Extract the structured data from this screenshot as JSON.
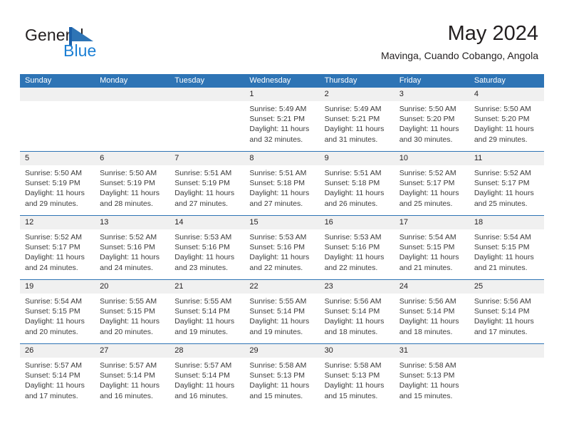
{
  "brand": {
    "name_part1": "General",
    "name_part2": "Blue",
    "logo_icon": "blue-flag-triangle-logo",
    "accent_color": "#1b7fd4"
  },
  "header": {
    "month_title": "May 2024",
    "location": "Mavinga, Cuando Cobango, Angola"
  },
  "theme": {
    "header_blue": "#2e74b5",
    "daynum_band": "#f0f0f0",
    "text": "#231f20",
    "detail_text": "#3b3b3b"
  },
  "calendar": {
    "weekday_headers": [
      "Sunday",
      "Monday",
      "Tuesday",
      "Wednesday",
      "Thursday",
      "Friday",
      "Saturday"
    ],
    "weeks": [
      [
        {
          "day": "",
          "lines": []
        },
        {
          "day": "",
          "lines": []
        },
        {
          "day": "",
          "lines": []
        },
        {
          "day": "1",
          "lines": [
            "Sunrise: 5:49 AM",
            "Sunset: 5:21 PM",
            "Daylight: 11 hours",
            "and 32 minutes."
          ]
        },
        {
          "day": "2",
          "lines": [
            "Sunrise: 5:49 AM",
            "Sunset: 5:21 PM",
            "Daylight: 11 hours",
            "and 31 minutes."
          ]
        },
        {
          "day": "3",
          "lines": [
            "Sunrise: 5:50 AM",
            "Sunset: 5:20 PM",
            "Daylight: 11 hours",
            "and 30 minutes."
          ]
        },
        {
          "day": "4",
          "lines": [
            "Sunrise: 5:50 AM",
            "Sunset: 5:20 PM",
            "Daylight: 11 hours",
            "and 29 minutes."
          ]
        }
      ],
      [
        {
          "day": "5",
          "lines": [
            "Sunrise: 5:50 AM",
            "Sunset: 5:19 PM",
            "Daylight: 11 hours",
            "and 29 minutes."
          ]
        },
        {
          "day": "6",
          "lines": [
            "Sunrise: 5:50 AM",
            "Sunset: 5:19 PM",
            "Daylight: 11 hours",
            "and 28 minutes."
          ]
        },
        {
          "day": "7",
          "lines": [
            "Sunrise: 5:51 AM",
            "Sunset: 5:19 PM",
            "Daylight: 11 hours",
            "and 27 minutes."
          ]
        },
        {
          "day": "8",
          "lines": [
            "Sunrise: 5:51 AM",
            "Sunset: 5:18 PM",
            "Daylight: 11 hours",
            "and 27 minutes."
          ]
        },
        {
          "day": "9",
          "lines": [
            "Sunrise: 5:51 AM",
            "Sunset: 5:18 PM",
            "Daylight: 11 hours",
            "and 26 minutes."
          ]
        },
        {
          "day": "10",
          "lines": [
            "Sunrise: 5:52 AM",
            "Sunset: 5:17 PM",
            "Daylight: 11 hours",
            "and 25 minutes."
          ]
        },
        {
          "day": "11",
          "lines": [
            "Sunrise: 5:52 AM",
            "Sunset: 5:17 PM",
            "Daylight: 11 hours",
            "and 25 minutes."
          ]
        }
      ],
      [
        {
          "day": "12",
          "lines": [
            "Sunrise: 5:52 AM",
            "Sunset: 5:17 PM",
            "Daylight: 11 hours",
            "and 24 minutes."
          ]
        },
        {
          "day": "13",
          "lines": [
            "Sunrise: 5:52 AM",
            "Sunset: 5:16 PM",
            "Daylight: 11 hours",
            "and 24 minutes."
          ]
        },
        {
          "day": "14",
          "lines": [
            "Sunrise: 5:53 AM",
            "Sunset: 5:16 PM",
            "Daylight: 11 hours",
            "and 23 minutes."
          ]
        },
        {
          "day": "15",
          "lines": [
            "Sunrise: 5:53 AM",
            "Sunset: 5:16 PM",
            "Daylight: 11 hours",
            "and 22 minutes."
          ]
        },
        {
          "day": "16",
          "lines": [
            "Sunrise: 5:53 AM",
            "Sunset: 5:16 PM",
            "Daylight: 11 hours",
            "and 22 minutes."
          ]
        },
        {
          "day": "17",
          "lines": [
            "Sunrise: 5:54 AM",
            "Sunset: 5:15 PM",
            "Daylight: 11 hours",
            "and 21 minutes."
          ]
        },
        {
          "day": "18",
          "lines": [
            "Sunrise: 5:54 AM",
            "Sunset: 5:15 PM",
            "Daylight: 11 hours",
            "and 21 minutes."
          ]
        }
      ],
      [
        {
          "day": "19",
          "lines": [
            "Sunrise: 5:54 AM",
            "Sunset: 5:15 PM",
            "Daylight: 11 hours",
            "and 20 minutes."
          ]
        },
        {
          "day": "20",
          "lines": [
            "Sunrise: 5:55 AM",
            "Sunset: 5:15 PM",
            "Daylight: 11 hours",
            "and 20 minutes."
          ]
        },
        {
          "day": "21",
          "lines": [
            "Sunrise: 5:55 AM",
            "Sunset: 5:14 PM",
            "Daylight: 11 hours",
            "and 19 minutes."
          ]
        },
        {
          "day": "22",
          "lines": [
            "Sunrise: 5:55 AM",
            "Sunset: 5:14 PM",
            "Daylight: 11 hours",
            "and 19 minutes."
          ]
        },
        {
          "day": "23",
          "lines": [
            "Sunrise: 5:56 AM",
            "Sunset: 5:14 PM",
            "Daylight: 11 hours",
            "and 18 minutes."
          ]
        },
        {
          "day": "24",
          "lines": [
            "Sunrise: 5:56 AM",
            "Sunset: 5:14 PM",
            "Daylight: 11 hours",
            "and 18 minutes."
          ]
        },
        {
          "day": "25",
          "lines": [
            "Sunrise: 5:56 AM",
            "Sunset: 5:14 PM",
            "Daylight: 11 hours",
            "and 17 minutes."
          ]
        }
      ],
      [
        {
          "day": "26",
          "lines": [
            "Sunrise: 5:57 AM",
            "Sunset: 5:14 PM",
            "Daylight: 11 hours",
            "and 17 minutes."
          ]
        },
        {
          "day": "27",
          "lines": [
            "Sunrise: 5:57 AM",
            "Sunset: 5:14 PM",
            "Daylight: 11 hours",
            "and 16 minutes."
          ]
        },
        {
          "day": "28",
          "lines": [
            "Sunrise: 5:57 AM",
            "Sunset: 5:14 PM",
            "Daylight: 11 hours",
            "and 16 minutes."
          ]
        },
        {
          "day": "29",
          "lines": [
            "Sunrise: 5:58 AM",
            "Sunset: 5:13 PM",
            "Daylight: 11 hours",
            "and 15 minutes."
          ]
        },
        {
          "day": "30",
          "lines": [
            "Sunrise: 5:58 AM",
            "Sunset: 5:13 PM",
            "Daylight: 11 hours",
            "and 15 minutes."
          ]
        },
        {
          "day": "31",
          "lines": [
            "Sunrise: 5:58 AM",
            "Sunset: 5:13 PM",
            "Daylight: 11 hours",
            "and 15 minutes."
          ]
        },
        {
          "day": "",
          "lines": []
        }
      ]
    ]
  }
}
